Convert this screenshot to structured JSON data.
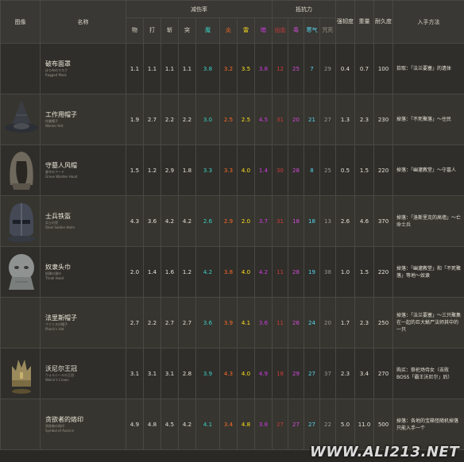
{
  "header": {
    "image": "图像",
    "name": "名称",
    "absorption_group": "减伤率",
    "resistance_group": "抵抗力",
    "poise": "强韧度",
    "weight": "重量",
    "durability": "耐久度",
    "source": "入手方法",
    "absorption_cols": [
      "物",
      "打",
      "斩",
      "突",
      "魔",
      "炎",
      "雷",
      "暗"
    ],
    "resistance_cols": [
      "出血",
      "毒",
      "寒气",
      "咒死"
    ]
  },
  "colors": {
    "magic": "#3ad4c8",
    "fire": "#ff6a28",
    "lightning": "#ffe020",
    "dark": "#d23ae6",
    "bleed": "#d03b3b",
    "poison": "#d24bd8",
    "frost": "#55d6f0",
    "curse": "#9a968a"
  },
  "watermark": "WWW.ALI213.NET",
  "rows": [
    {
      "zh": "破布面罩",
      "jp": "ぼろ布のマスク",
      "en": "Ragged Mask",
      "helm": "none",
      "abs": [
        "1.1",
        "1.1",
        "1.1",
        "1.1",
        "3.8",
        "3.2",
        "3.5",
        "3.8"
      ],
      "res": [
        "12",
        "25",
        "7",
        "29"
      ],
      "poise": "0.4",
      "weight": "0.7",
      "dur": "100",
      "src": "拾取：「法兰要塞」的遗体"
    },
    {
      "zh": "工作用帽子",
      "jp": "作業帽子",
      "en": "Worker Hat",
      "helm": "witch",
      "abs": [
        "1.9",
        "2.7",
        "2.2",
        "2.2",
        "3.0",
        "2.5",
        "2.5",
        "4.5"
      ],
      "res": [
        "31",
        "20",
        "21",
        "27"
      ],
      "poise": "1.3",
      "weight": "2.3",
      "dur": "230",
      "src": "掉落：「不死聚落」～住民"
    },
    {
      "zh": "守墓人风帽",
      "jp": "墓守のフード",
      "en": "Grave Warden Hood",
      "helm": "hood",
      "abs": [
        "1.5",
        "1.2",
        "2.9",
        "1.8",
        "3.3",
        "3.3",
        "4.0",
        "1.4"
      ],
      "res": [
        "30",
        "28",
        "8",
        "25"
      ],
      "poise": "0.5",
      "weight": "1.5",
      "dur": "220",
      "src": "掉落：「幽邃教堂」～守墓人"
    },
    {
      "zh": "士兵铁盔",
      "jp": "兵士の兜",
      "en": "Steel Soldier Helm",
      "helm": "steel",
      "abs": [
        "4.3",
        "3.6",
        "4.2",
        "4.2",
        "2.6",
        "2.9",
        "2.0",
        "3.7"
      ],
      "res": [
        "31",
        "18",
        "18",
        "13"
      ],
      "poise": "2.6",
      "weight": "4.6",
      "dur": "370",
      "src": "掉落：「洛斯里克的高墙」～亡命士兵"
    },
    {
      "zh": "奴隶头巾",
      "jp": "奴隷の頭巾",
      "en": "Thrall Hood",
      "helm": "sack",
      "abs": [
        "2.0",
        "1.4",
        "1.6",
        "1.2",
        "4.2",
        "3.8",
        "4.0",
        "4.2"
      ],
      "res": [
        "11",
        "28",
        "19",
        "38"
      ],
      "poise": "1.0",
      "weight": "1.5",
      "dur": "220",
      "src": "掉落：「幽邃教堂」和「不死聚落」等地～奴隶"
    },
    {
      "zh": "法里斯帽子",
      "jp": "ファリスの帽子",
      "en": "Pharis's Hat",
      "helm": "none",
      "abs": [
        "2.7",
        "2.2",
        "2.7",
        "2.7",
        "3.6",
        "3.9",
        "4.1",
        "3.6"
      ],
      "res": [
        "11",
        "26",
        "24",
        "20"
      ],
      "poise": "1.7",
      "weight": "2.3",
      "dur": "250",
      "src": "掉落：「法兰要塞」～三只聚集在一起的巨大蜥尸法师其中的一只"
    },
    {
      "zh": "沃尼尔王冠",
      "jp": "ウォルニールの王冠",
      "en": "Wolnir's Crown",
      "helm": "crown",
      "abs": [
        "3.1",
        "3.1",
        "3.1",
        "2.8",
        "3.9",
        "4.3",
        "4.0",
        "4.9"
      ],
      "res": [
        "18",
        "29",
        "27",
        "37"
      ],
      "poise": "2.3",
      "weight": "3.4",
      "dur": "270",
      "src": "购买：祭祀场侍女（击败BOSS「霸王沃尼尔」后）"
    },
    {
      "zh": "贪欲者的烙印",
      "jp": "貪欲者の烙印",
      "en": "Symbol of Avarice",
      "helm": "none",
      "abs": [
        "4.9",
        "4.8",
        "4.5",
        "4.2",
        "4.1",
        "3.4",
        "4.8",
        "3.8"
      ],
      "res": [
        "27",
        "27",
        "27",
        "22"
      ],
      "poise": "5.0",
      "weight": "11.0",
      "dur": "500",
      "src": "掉落：各地的宝箱怪随机掉落 只能入手一个"
    }
  ]
}
